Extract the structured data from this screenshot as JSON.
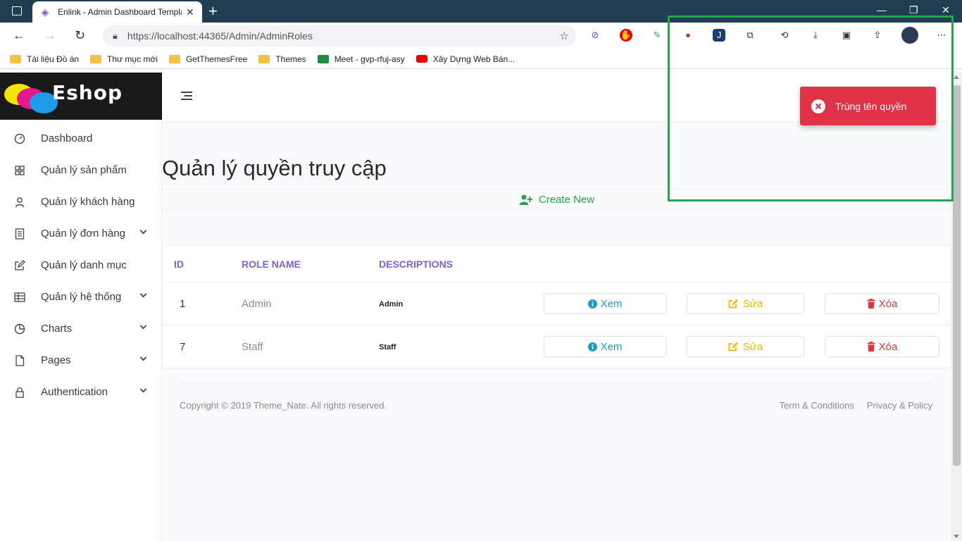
{
  "browser": {
    "tab_title": "Enlink - Admin Dashboard Template",
    "url": "https://localhost:44365/Admin/AdminRoles",
    "bookmarks": [
      {
        "label": "Tài liệu Đồ án",
        "icon": "folder-icon"
      },
      {
        "label": "Thư mục mới",
        "icon": "folder-icon"
      },
      {
        "label": "GetThemesFree",
        "icon": "folder-icon"
      },
      {
        "label": "Themes",
        "icon": "folder-icon"
      },
      {
        "label": "Meet - gvp-rfuj-asy",
        "icon": "meet-icon"
      },
      {
        "label": "Xây Dựng Web Bán...",
        "icon": "youtube-icon"
      }
    ]
  },
  "brand": {
    "logo_text": "Eshop"
  },
  "sidebar": {
    "items": [
      {
        "label": "Dashboard",
        "icon": "gauge-icon",
        "has_children": false
      },
      {
        "label": "Quản lý sản phẩm",
        "icon": "grid-icon",
        "has_children": false
      },
      {
        "label": "Quản lý khách hàng",
        "icon": "user-icon",
        "has_children": false
      },
      {
        "label": "Quản lý đơn hàng",
        "icon": "document-icon",
        "has_children": true
      },
      {
        "label": "Quản lý danh mục",
        "icon": "edit-icon",
        "has_children": false
      },
      {
        "label": "Quản lý hệ thống",
        "icon": "table-icon",
        "has_children": true
      },
      {
        "label": "Charts",
        "icon": "pie-chart-icon",
        "has_children": true
      },
      {
        "label": "Pages",
        "icon": "file-icon",
        "has_children": true
      },
      {
        "label": "Authentication",
        "icon": "lock-icon",
        "has_children": true
      }
    ]
  },
  "page": {
    "title": "Quản lý quyền truy cập",
    "create_label": "Create New"
  },
  "table": {
    "headers": {
      "id": "ID",
      "name": "ROLE NAME",
      "desc": "DESCRIPTIONS"
    },
    "rows": [
      {
        "id": "1",
        "name": "Admin",
        "desc": "Admin"
      },
      {
        "id": "7",
        "name": "Staff",
        "desc": "Staff"
      }
    ],
    "actions": {
      "view": "Xem",
      "edit": "Sửa",
      "delete": "Xóa"
    }
  },
  "footer": {
    "copyright": "Copyright © 2019 Theme_Nate. All rights reserved.",
    "terms": "Term & Conditions",
    "privacy": "Privacy & Policy"
  },
  "toast": {
    "message": "Trùng tên quyền",
    "type": "error"
  },
  "colors": {
    "accent": "#7b61d9",
    "success": "#2a9d4a",
    "danger": "#e03346",
    "info": "#1f9cc3",
    "warning": "#f0b800",
    "highlight": "#22a84a"
  }
}
